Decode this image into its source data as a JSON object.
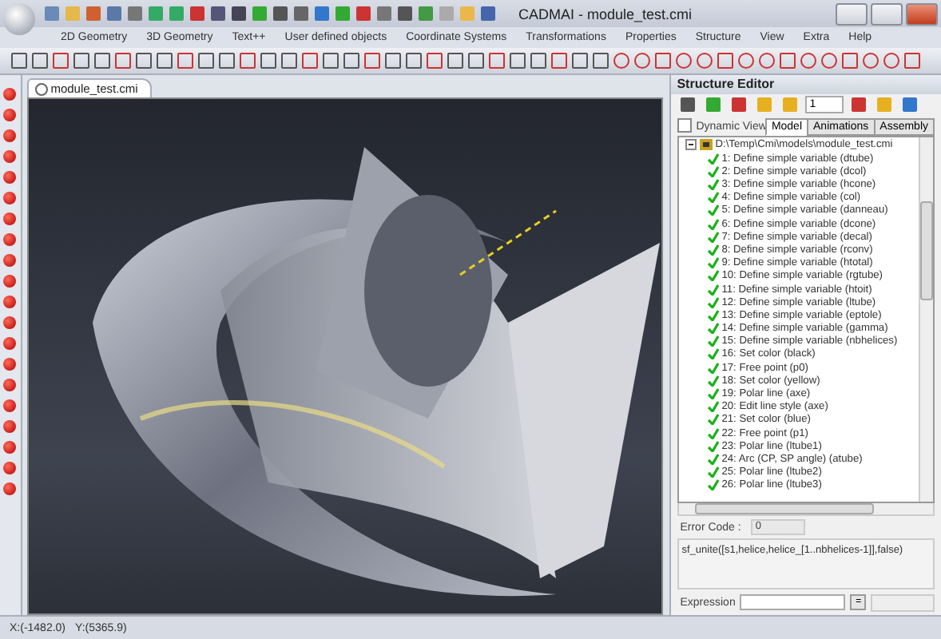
{
  "window": {
    "title": "CADMAI - module_test.cmi"
  },
  "menu": [
    "2D Geometry",
    "3D Geometry",
    "Text++",
    "User defined objects",
    "Coordinate Systems",
    "Transformations",
    "Properties",
    "Structure",
    "View",
    "Extra",
    "Help"
  ],
  "viewport": {
    "tab": "module_test.cmi"
  },
  "structure_editor": {
    "title": "Structure Editor",
    "layer_value": "1",
    "dynamic_view": {
      "label": "Dynamic View",
      "checked": false
    },
    "tabs": [
      {
        "label": "Model",
        "selected": true
      },
      {
        "label": "Animations",
        "selected": false
      },
      {
        "label": "Assembly",
        "selected": false
      }
    ],
    "tree": {
      "label": "D:\\Temp\\Cmi\\models\\module_test.cmi",
      "expanded": true,
      "children": [
        {
          "label": "1: Define simple variable (dtube)",
          "checked": true
        },
        {
          "label": "2: Define simple variable (dcol)",
          "checked": true
        },
        {
          "label": "3: Define simple variable (hcone)",
          "checked": true
        },
        {
          "label": "4: Define simple variable (col)",
          "checked": true
        },
        {
          "label": "5: Define simple variable (danneau)",
          "checked": true
        },
        {
          "label": "6: Define simple variable (dcone)",
          "checked": true
        },
        {
          "label": "7: Define simple variable (decal)",
          "checked": true
        },
        {
          "label": "8: Define simple variable (rconv)",
          "checked": true
        },
        {
          "label": "9: Define simple variable (htotal)",
          "checked": true
        },
        {
          "label": "10: Define simple variable (rgtube)",
          "checked": true
        },
        {
          "label": "11: Define simple variable (htoit)",
          "checked": true
        },
        {
          "label": "12: Define simple variable (ltube)",
          "checked": true
        },
        {
          "label": "13: Define simple variable (eptole)",
          "checked": true
        },
        {
          "label": "14: Define simple variable (gamma)",
          "checked": true
        },
        {
          "label": "15: Define simple variable (nbhelices)",
          "checked": true
        },
        {
          "label": "16: Set color (black)",
          "checked": true
        },
        {
          "label": "17: Free point (p0)",
          "checked": true
        },
        {
          "label": "18: Set color (yellow)",
          "checked": true
        },
        {
          "label": "19: Polar line (axe)",
          "checked": true
        },
        {
          "label": "20: Edit line style (axe)",
          "checked": true
        },
        {
          "label": "21: Set color (blue)",
          "checked": true
        },
        {
          "label": "22: Free point (p1)",
          "checked": true
        },
        {
          "label": "23: Polar line (ltube1)",
          "checked": true
        },
        {
          "label": "24: Arc (CP, SP angle) (atube)",
          "checked": true
        },
        {
          "label": "25: Polar line (ltube2)",
          "checked": true
        },
        {
          "label": "26: Polar line (ltube3)",
          "checked": true
        }
      ]
    },
    "error_code": {
      "label": "Error Code :",
      "value": "0"
    },
    "expression_text": "sf_unite([s1,helice,helice_[1..nbhelices-1]],false)",
    "expression": {
      "label": "Expression",
      "button": "="
    }
  },
  "status_bar": {
    "x": "X:(-1482.0)",
    "y": "Y:(5365.9)"
  }
}
